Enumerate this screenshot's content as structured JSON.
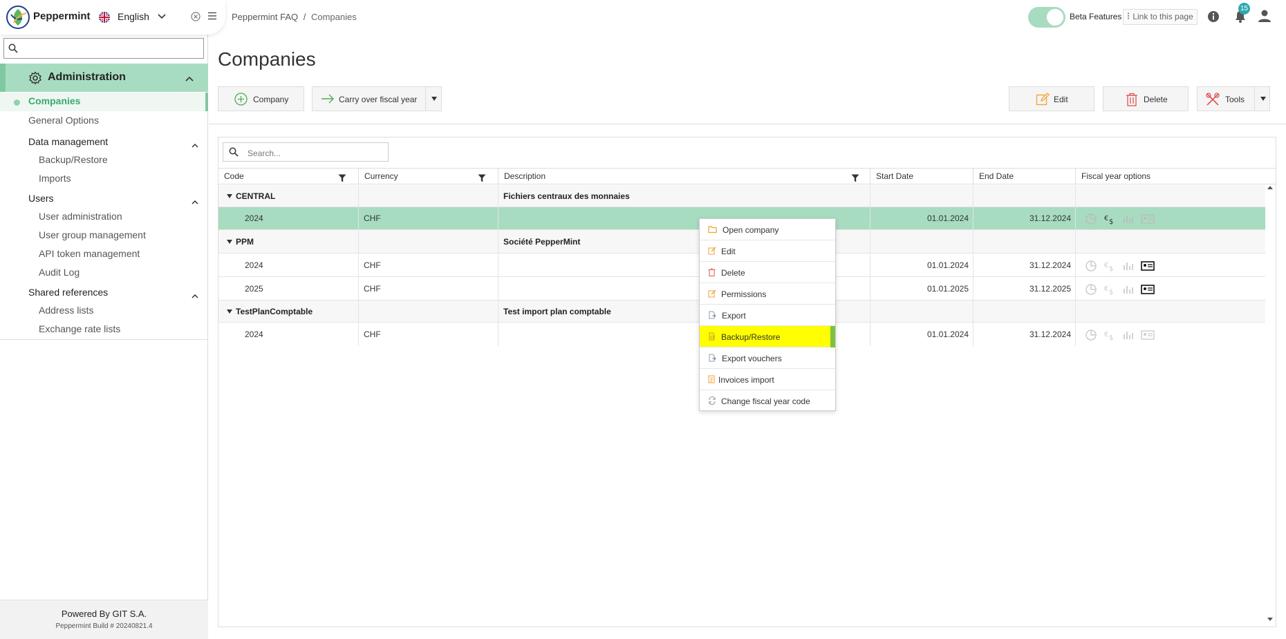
{
  "app": {
    "name": "Peppermint",
    "language": "English",
    "beta_label": "Beta Features",
    "link_label": "Link to this page",
    "notifications_count": "15"
  },
  "breadcrumb": {
    "root": "Peppermint FAQ",
    "sep": "/",
    "current": "Companies"
  },
  "sidebar": {
    "search_placeholder": "",
    "section_title": "Administration",
    "items": {
      "companies": "Companies",
      "general_options": "General Options",
      "data_management": "Data management",
      "backup_restore": "Backup/Restore",
      "imports": "Imports",
      "users": "Users",
      "user_administration": "User administration",
      "user_group_management": "User group management",
      "api_token_management": "API token management",
      "audit_log": "Audit Log",
      "shared_references": "Shared references",
      "address_lists": "Address lists",
      "exchange_rate_lists": "Exchange rate lists"
    },
    "footer": {
      "powered": "Powered By GIT S.A.",
      "build": "Peppermint Build # 20240821.4"
    }
  },
  "page": {
    "title": "Companies"
  },
  "toolbar": {
    "company": "Company",
    "carry_over": "Carry over fiscal year",
    "edit": "Edit",
    "delete": "Delete",
    "tools": "Tools"
  },
  "grid": {
    "search_placeholder": "Search...",
    "columns": {
      "code": "Code",
      "currency": "Currency",
      "description": "Description",
      "start_date": "Start Date",
      "end_date": "End Date",
      "fiscal_options": "Fiscal year options"
    },
    "rows": [
      {
        "type": "group",
        "code": "CENTRAL",
        "description": "Fichiers centraux des monnaies"
      },
      {
        "type": "item",
        "code": "2024",
        "currency": "CHF",
        "start": "01.01.2024",
        "end": "31.12.2024",
        "selected": true
      },
      {
        "type": "group",
        "code": "PPM",
        "description": "Société PepperMint"
      },
      {
        "type": "item",
        "code": "2024",
        "currency": "CHF",
        "start": "01.01.2024",
        "end": "31.12.2024"
      },
      {
        "type": "item",
        "code": "2025",
        "currency": "CHF",
        "start": "01.01.2025",
        "end": "31.12.2025"
      },
      {
        "type": "group",
        "code": "TestPlanComptable",
        "description": "Test import plan comptable"
      },
      {
        "type": "item",
        "code": "2024",
        "currency": "CHF",
        "start": "01.01.2024",
        "end": "31.12.2024"
      }
    ]
  },
  "context_menu": {
    "open_company": "Open company",
    "edit": "Edit",
    "delete": "Delete",
    "permissions": "Permissions",
    "export": "Export",
    "backup_restore": "Backup/Restore",
    "export_vouchers": "Export vouchers",
    "invoices_import": "Invoices import",
    "change_fy_code": "Change fiscal year code"
  },
  "colors": {
    "accent_green": "#a8dcc0",
    "active_text": "#3aaa6e",
    "highlight_yellow": "#ffff00",
    "badge": "#2fa7b0"
  }
}
